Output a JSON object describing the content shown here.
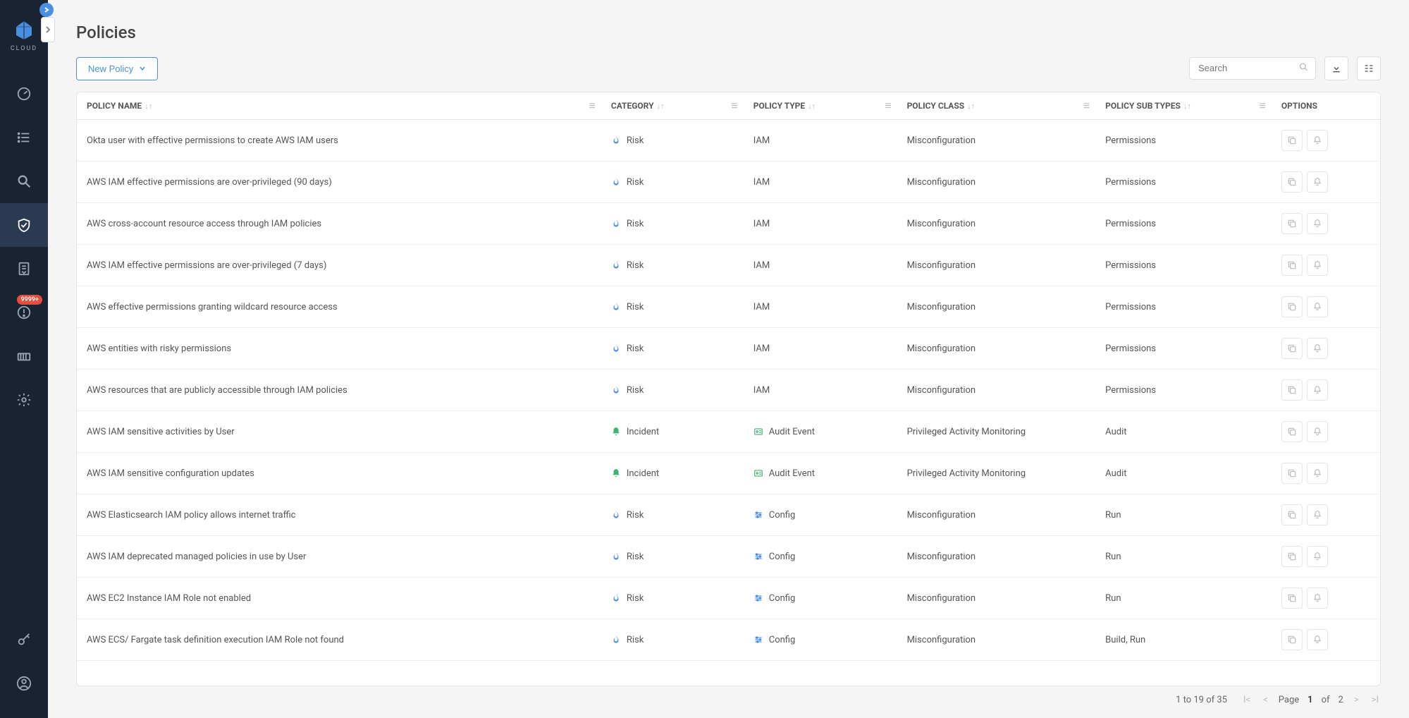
{
  "brand": {
    "name": "CLOUD"
  },
  "sidebar": {
    "expand_chevron": "›",
    "items": [
      {
        "name": "dashboard",
        "active": false
      },
      {
        "name": "list",
        "active": false
      },
      {
        "name": "search",
        "active": false
      },
      {
        "name": "shield",
        "active": true
      },
      {
        "name": "document",
        "active": false
      },
      {
        "name": "alert",
        "active": false,
        "badge": "9999+"
      },
      {
        "name": "container",
        "active": false
      },
      {
        "name": "settings",
        "active": false
      }
    ],
    "bottom": [
      {
        "name": "key"
      },
      {
        "name": "profile"
      }
    ]
  },
  "page": {
    "title": "Policies"
  },
  "toolbar": {
    "new_policy_label": "New Policy",
    "search_placeholder": "Search"
  },
  "columns": {
    "name": "POLICY NAME",
    "category": "CATEGORY",
    "type": "POLICY TYPE",
    "class": "POLICY CLASS",
    "subtypes": "POLICY SUB TYPES",
    "options": "OPTIONS"
  },
  "category_labels": {
    "risk": "Risk",
    "incident": "Incident"
  },
  "type_labels": {
    "iam": "IAM",
    "audit": "Audit Event",
    "config": "Config"
  },
  "rows": [
    {
      "name": "Okta user with effective permissions to create AWS IAM users",
      "category": "risk",
      "type": "iam",
      "class": "Misconfiguration",
      "subtypes": "Permissions"
    },
    {
      "name": "AWS IAM effective permissions are over-privileged (90 days)",
      "category": "risk",
      "type": "iam",
      "class": "Misconfiguration",
      "subtypes": "Permissions"
    },
    {
      "name": "AWS cross-account resource access through IAM policies",
      "category": "risk",
      "type": "iam",
      "class": "Misconfiguration",
      "subtypes": "Permissions"
    },
    {
      "name": "AWS IAM effective permissions are over-privileged (7 days)",
      "category": "risk",
      "type": "iam",
      "class": "Misconfiguration",
      "subtypes": "Permissions"
    },
    {
      "name": "AWS effective permissions granting wildcard resource access",
      "category": "risk",
      "type": "iam",
      "class": "Misconfiguration",
      "subtypes": "Permissions"
    },
    {
      "name": "AWS entities with risky permissions",
      "category": "risk",
      "type": "iam",
      "class": "Misconfiguration",
      "subtypes": "Permissions"
    },
    {
      "name": "AWS resources that are publicly accessible through IAM policies",
      "category": "risk",
      "type": "iam",
      "class": "Misconfiguration",
      "subtypes": "Permissions"
    },
    {
      "name": "AWS IAM sensitive activities by User",
      "category": "incident",
      "type": "audit",
      "class": "Privileged Activity Monitoring",
      "subtypes": "Audit"
    },
    {
      "name": "AWS IAM sensitive configuration updates",
      "category": "incident",
      "type": "audit",
      "class": "Privileged Activity Monitoring",
      "subtypes": "Audit"
    },
    {
      "name": "AWS Elasticsearch IAM policy allows internet traffic",
      "category": "risk",
      "type": "config",
      "class": "Misconfiguration",
      "subtypes": "Run"
    },
    {
      "name": "AWS IAM deprecated managed policies in use by User",
      "category": "risk",
      "type": "config",
      "class": "Misconfiguration",
      "subtypes": "Run"
    },
    {
      "name": "AWS EC2 Instance IAM Role not enabled",
      "category": "risk",
      "type": "config",
      "class": "Misconfiguration",
      "subtypes": "Run"
    },
    {
      "name": "AWS ECS/ Fargate task definition execution IAM Role not found",
      "category": "risk",
      "type": "config",
      "class": "Misconfiguration",
      "subtypes": "Build, Run"
    }
  ],
  "footer": {
    "range": "1 to 19 of 35",
    "page_label": "Page",
    "page_current": "1",
    "page_of": "of",
    "page_total": "2"
  }
}
